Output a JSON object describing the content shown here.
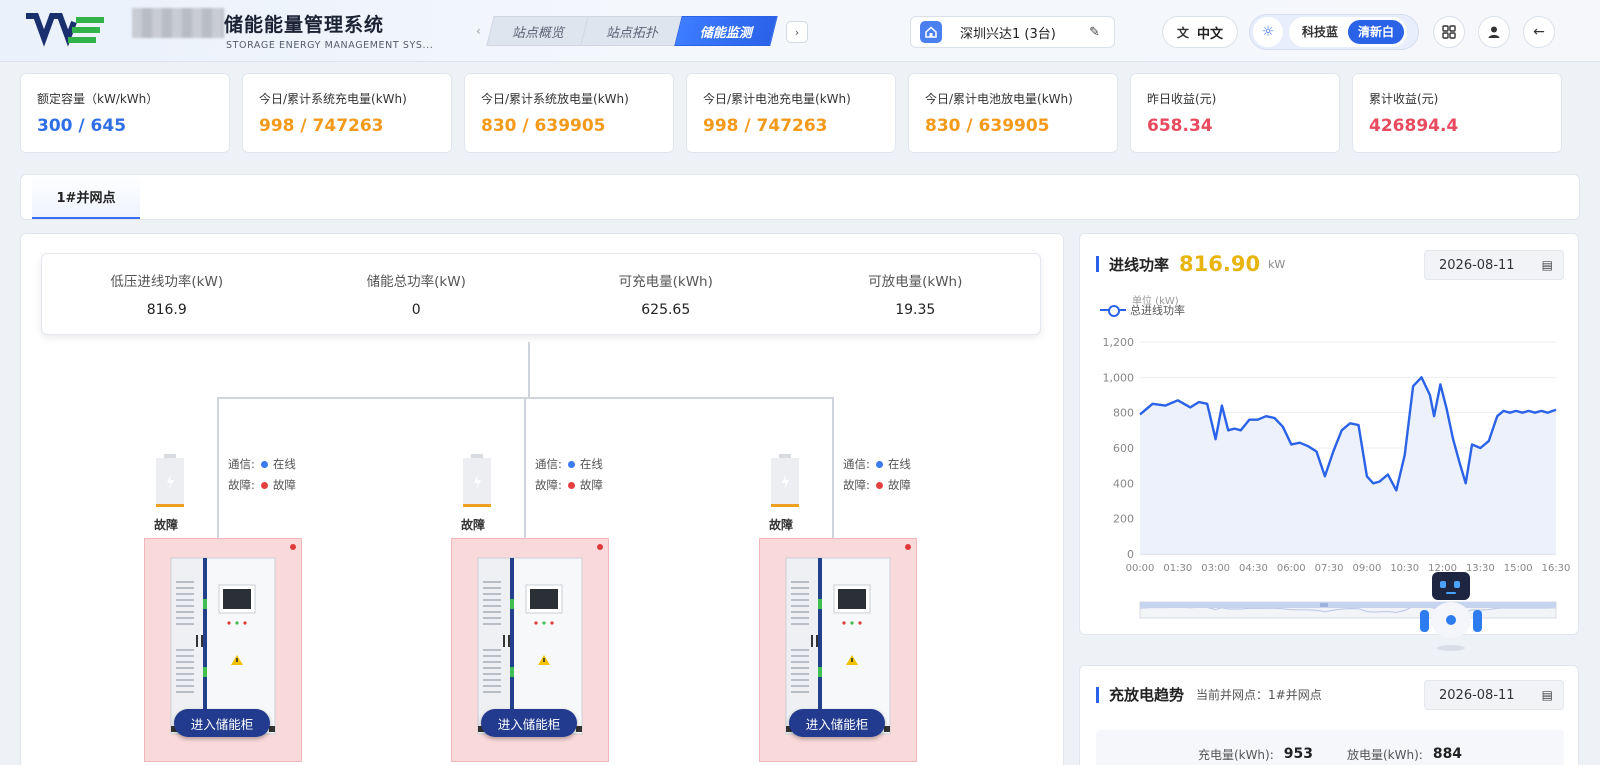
{
  "header": {
    "title": "储能能量管理系统",
    "subtitle": "STORAGE ENERGY MANAGEMENT SYS...",
    "nav_tabs": [
      "站点概览",
      "站点拓扑",
      "储能监测"
    ],
    "active_tab_index": 2,
    "site_name": "深圳兴达1 (3台)",
    "language": "中文",
    "theme_options": [
      "科技蓝",
      "清新白"
    ],
    "active_theme": "清新白"
  },
  "kpis": [
    {
      "label": "额定容量（kW/kWh）",
      "value": "300 / 645",
      "color": "#2f6fe6"
    },
    {
      "label": "今日/累计系统充电量(kWh)",
      "value": "998 / 747263",
      "color": "#f39a1b"
    },
    {
      "label": "今日/累计系统放电量(kWh)",
      "value": "830 / 639905",
      "color": "#f39a1b"
    },
    {
      "label": "今日/累计电池充电量(kWh)",
      "value": "998 / 747263",
      "color": "#f39a1b"
    },
    {
      "label": "今日/累计电池放电量(kWh)",
      "value": "830 / 639905",
      "color": "#f39a1b"
    },
    {
      "label": "昨日收益(元)",
      "value": "658.34",
      "color": "#e84a5f"
    },
    {
      "label": "累计收益(元)",
      "value": "426894.4",
      "color": "#e84a5f"
    }
  ],
  "grid_tab": "1#并网点",
  "topology": {
    "stats": [
      {
        "label": "低压进线功率(kW)",
        "value": "816.9"
      },
      {
        "label": "储能总功率(kW)",
        "value": "0"
      },
      {
        "label": "可充电量(kWh)",
        "value": "625.65"
      },
      {
        "label": "可放电量(kWh)",
        "value": "19.35"
      }
    ],
    "cabinets": [
      {
        "battery_status": "故障",
        "comm_label": "通信:",
        "comm_value": "在线",
        "fault_label": "故障:",
        "fault_value": "故障",
        "button": "进入储能柜"
      },
      {
        "battery_status": "故障",
        "comm_label": "通信:",
        "comm_value": "在线",
        "fault_label": "故障:",
        "fault_value": "故障",
        "button": "进入储能柜"
      },
      {
        "battery_status": "故障",
        "comm_label": "通信:",
        "comm_value": "在线",
        "fault_label": "故障:",
        "fault_value": "故障",
        "button": "进入储能柜"
      }
    ],
    "colors": {
      "online": "#3a7bf0",
      "fault": "#e53e3e"
    }
  },
  "power_panel": {
    "title": "进线功率",
    "value": "816.90",
    "unit": "kW",
    "date": "2026-08-11",
    "legend_unit": "单位 (kW)",
    "legend_series": "总进线功率"
  },
  "trend_panel": {
    "title": "充放电趋势",
    "subtitle": "当前并网点：1#并网点",
    "date": "2026-08-11",
    "charge_label": "充电量(kWh):",
    "charge_value": "953",
    "discharge_label": "放电量(kWh):",
    "discharge_value": "884"
  },
  "chart_data": {
    "type": "area",
    "title": "",
    "xlabel": "",
    "ylabel": "单位 (kW)",
    "ylim": [
      0,
      1200
    ],
    "yticks": [
      "0",
      "200",
      "400",
      "600",
      "800",
      "1,000",
      "1,200"
    ],
    "xticks": [
      "00:00",
      "01:30",
      "03:00",
      "04:30",
      "06:00",
      "07:30",
      "09:00",
      "10:30",
      "12:00",
      "13:30",
      "15:00",
      "16:30"
    ],
    "series": [
      {
        "name": "总进线功率",
        "x_minutes": [
          0,
          30,
          60,
          90,
          120,
          140,
          160,
          180,
          195,
          210,
          225,
          240,
          260,
          280,
          300,
          320,
          340,
          360,
          380,
          400,
          420,
          440,
          460,
          480,
          500,
          520,
          540,
          555,
          570,
          590,
          610,
          630,
          650,
          670,
          690,
          700,
          715,
          730,
          745,
          760,
          775,
          790,
          810,
          830,
          850,
          865,
          880,
          895,
          910,
          925,
          940,
          955,
          970,
          990
        ],
        "values": [
          790,
          850,
          840,
          870,
          830,
          860,
          850,
          650,
          840,
          700,
          710,
          700,
          760,
          760,
          780,
          770,
          720,
          620,
          630,
          610,
          580,
          440,
          580,
          700,
          740,
          730,
          440,
          400,
          410,
          450,
          360,
          560,
          950,
          1000,
          900,
          780,
          960,
          820,
          650,
          520,
          400,
          620,
          600,
          640,
          780,
          810,
          800,
          810,
          800,
          810,
          800,
          810,
          800,
          816
        ],
        "color": "#2a62e8"
      }
    ],
    "grid": true,
    "legend": "top-left"
  }
}
